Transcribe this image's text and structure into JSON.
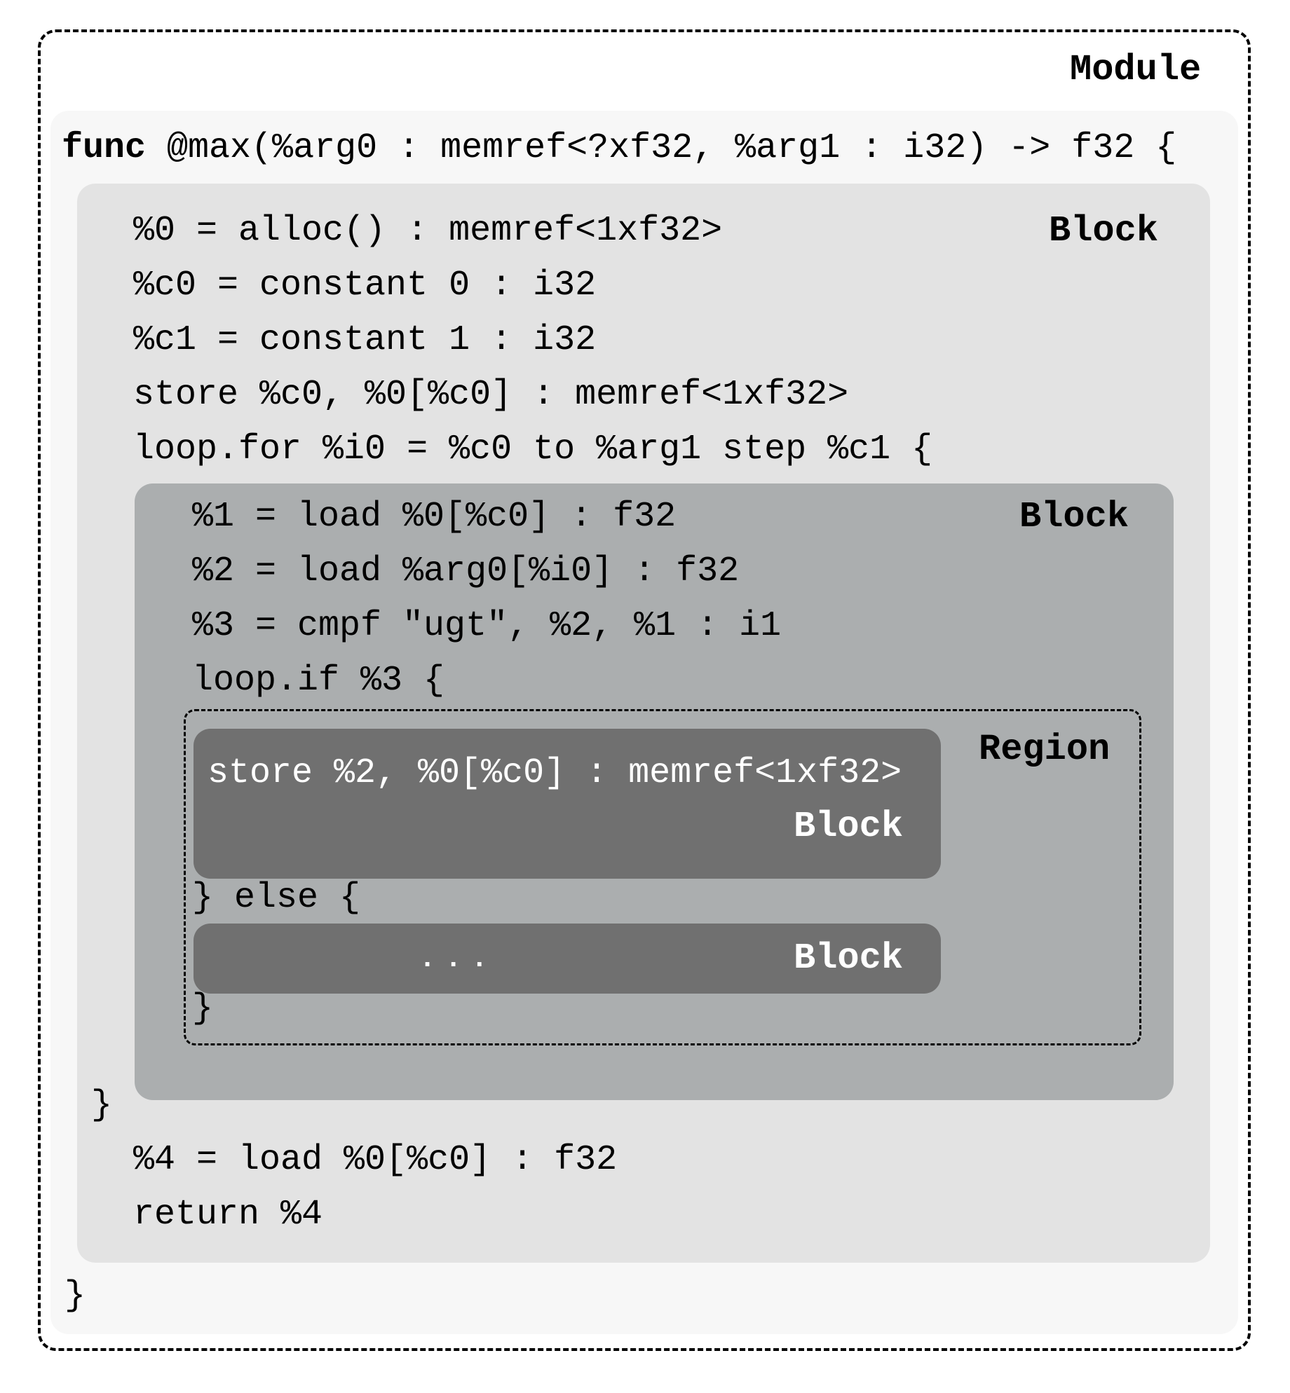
{
  "labels": {
    "module": "Module",
    "block": "Block",
    "region": "Region"
  },
  "code": {
    "func_keyword": "func",
    "func_signature": " @max(%arg0 : memref<?xf32, %arg1 : i32) -> f32 {",
    "outer_block": [
      "%0 = alloc() : memref<1xf32>",
      "%c0 = constant 0 : i32",
      "%c1 = constant 1 : i32",
      "store %c0, %0[%c0] : memref<1xf32>",
      "loop.for %i0 = %c0 to %arg1 step %c1 {"
    ],
    "loop_block": [
      "%1 = load %0[%c0] : f32",
      "%2 = load %arg0[%i0] : f32",
      "%3 = cmpf \"ugt\", %2, %1 : i1",
      "loop.if %3 {"
    ],
    "then_block": "store %2, %0[%c0] : memref<1xf32>",
    "else_line": "} else {",
    "else_block": "...",
    "if_close": "}",
    "loop_close": "}",
    "after_loop": [
      "%4 = load %0[%c0] : f32",
      "return %4"
    ],
    "func_close": "}"
  }
}
